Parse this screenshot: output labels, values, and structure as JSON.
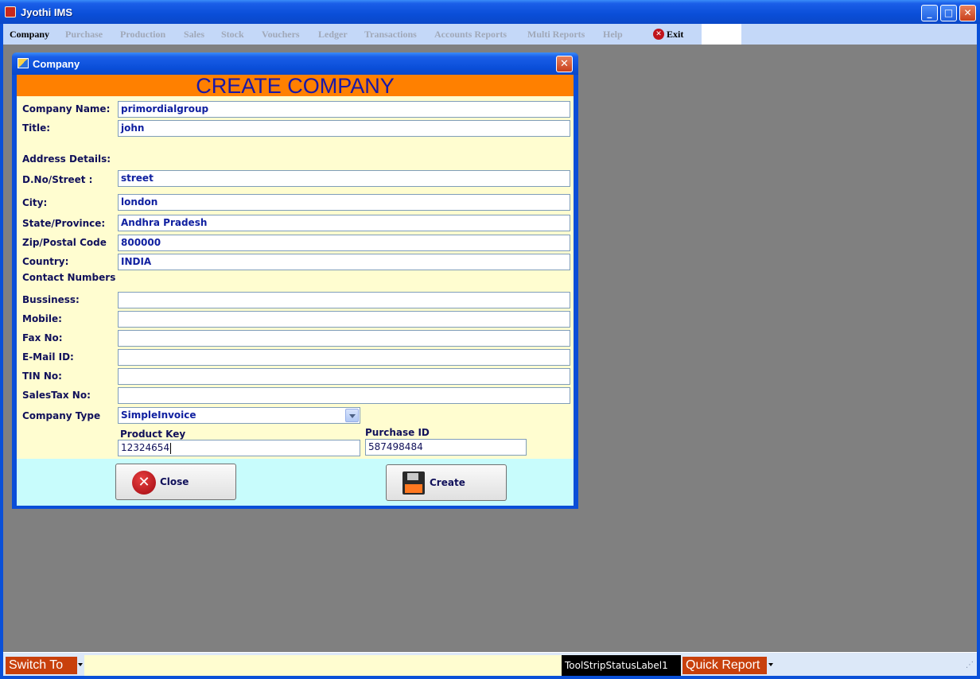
{
  "app": {
    "title": "Jyothi IMS"
  },
  "window_controls": {
    "minimize": "_",
    "maximize": "□",
    "close": "✕"
  },
  "menu": {
    "items": [
      "Company",
      "Purchase",
      "Production",
      "Sales",
      "Stock",
      "Vouchers",
      "Ledger",
      "Transactions",
      "Accounts Reports",
      "Multi Reports",
      "Help"
    ],
    "exit_label": "Exit"
  },
  "dialog": {
    "title": "Company",
    "close_glyph": "✕",
    "header": "CREATE COMPANY",
    "labels": {
      "company_name": "Company Name:",
      "title": "Title:",
      "address_details": "Address Details:",
      "street": "D.No/Street :",
      "city": "City:",
      "state": "State/Province:",
      "zip": "Zip/Postal Code",
      "country": "Country:",
      "contact_numbers": "Contact Numbers",
      "business": "Bussiness:",
      "mobile": "Mobile:",
      "fax": "Fax No:",
      "email": "E-Mail ID:",
      "tin": "TIN No:",
      "salestax": "SalesTax No:",
      "company_type": "Company Type",
      "product_key": "Product Key",
      "purchase_id": "Purchase ID"
    },
    "values": {
      "company_name": "primordialgroup",
      "title": "john",
      "street": "street",
      "city": "london",
      "state": "Andhra Pradesh",
      "zip": "800000",
      "country": "INDIA",
      "business": "",
      "mobile": "",
      "fax": "",
      "email": "",
      "tin": "",
      "salestax": "",
      "company_type": "SimpleInvoice",
      "product_key": "12324654",
      "purchase_id": "587498484"
    },
    "buttons": {
      "close": "Close",
      "create": "Create"
    }
  },
  "status": {
    "switch_to": "Switch To",
    "label": "ToolStripStatusLabel1",
    "quick_report": "Quick Report"
  },
  "colors": {
    "header_band": "#ff8000",
    "form_bg": "#fffdd0",
    "button_band": "#c8fcfc",
    "title_blue": "#0a4ed8",
    "header_text": "#1818a8"
  }
}
